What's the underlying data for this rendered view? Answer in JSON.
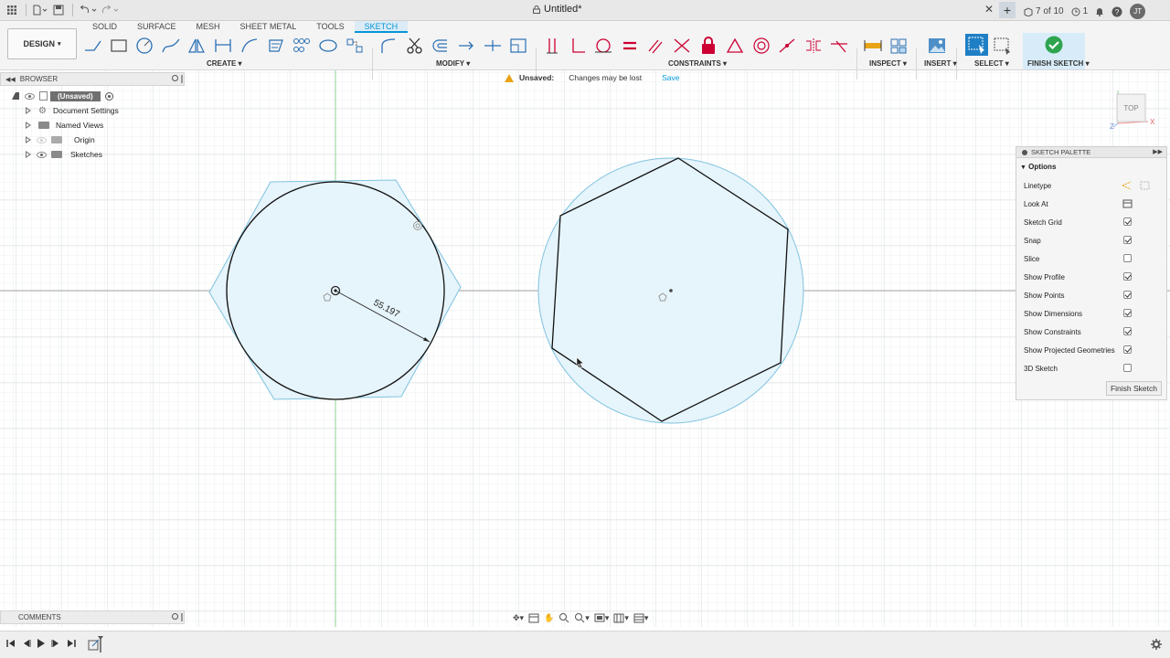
{
  "titlebar": {
    "doc_title": "Untitled*",
    "version_label": "7 of 10",
    "job_count": "1",
    "user_initials": "JT"
  },
  "ribbon": {
    "workspace_label": "DESIGN",
    "tabs": [
      "SOLID",
      "SURFACE",
      "MESH",
      "SHEET METAL",
      "TOOLS",
      "SKETCH"
    ],
    "active_tab": "SKETCH",
    "groups": {
      "create": "CREATE",
      "modify": "MODIFY",
      "constraints": "CONSTRAINTS",
      "inspect": "INSPECT",
      "insert": "INSERT",
      "select": "SELECT",
      "finish": "FINISH SKETCH"
    }
  },
  "browser": {
    "title": "BROWSER",
    "root": "(Unsaved)",
    "items": [
      {
        "label": "Document Settings",
        "icon": "gear-icon"
      },
      {
        "label": "Named Views",
        "icon": "folder-icon"
      },
      {
        "label": "Origin",
        "icon": "folder-icon"
      },
      {
        "label": "Sketches",
        "icon": "folder-icon"
      }
    ]
  },
  "banner": {
    "label": "Unsaved:",
    "message": "Changes may be lost",
    "save_link": "Save"
  },
  "canvas": {
    "dimension": "55.197",
    "view_cube_label": "TOP",
    "axis_x": "X",
    "axis_z": "Z"
  },
  "palette": {
    "title": "SKETCH PALETTE",
    "section": "Options",
    "rows": [
      {
        "label": "Linetype",
        "control": "linetype"
      },
      {
        "label": "Look At",
        "control": "lookat"
      },
      {
        "label": "Sketch Grid",
        "checked": true
      },
      {
        "label": "Snap",
        "checked": true
      },
      {
        "label": "Slice",
        "checked": false
      },
      {
        "label": "Show Profile",
        "checked": true
      },
      {
        "label": "Show Points",
        "checked": true
      },
      {
        "label": "Show Dimensions",
        "checked": true
      },
      {
        "label": "Show Constraints",
        "checked": true
      },
      {
        "label": "Show Projected Geometries",
        "checked": true
      },
      {
        "label": "3D Sketch",
        "checked": false
      }
    ],
    "finish_button": "Finish Sketch"
  },
  "comments": {
    "title": "COMMENTS"
  },
  "colors": {
    "accent": "#0696d7",
    "profile_fill": "#e6f4fb",
    "projected_line": "#7fc3e0",
    "grid_major": "#d9dde2",
    "grid_minor": "#eef0f2"
  }
}
